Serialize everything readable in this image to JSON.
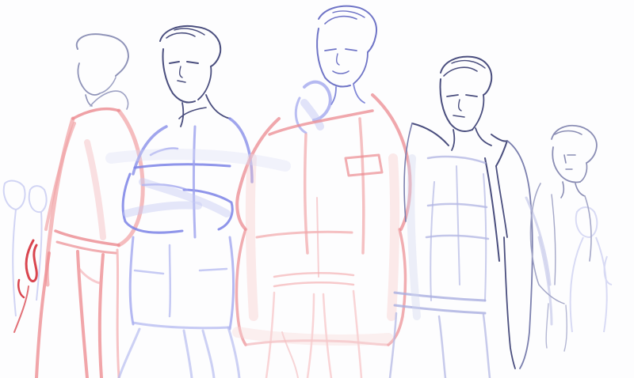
{
  "artwork": {
    "subject": "",
    "figures": [
      {
        "name": "figure-left-turtleneck"
      },
      {
        "name": "figure-arms-crossed"
      },
      {
        "name": "figure-center-hand-raised"
      },
      {
        "name": "figure-open-coat"
      },
      {
        "name": "figure-far-right-small"
      }
    ],
    "colors": {
      "background": "#fdfdfe",
      "red_sketch": "#e8686f",
      "red_light": "#f1a5a8",
      "blue_sketch": "#7b82e6",
      "blue_light": "#b7bcf0",
      "ink_line": "#4a4e7e",
      "grey_line": "#9ea2c4"
    }
  }
}
